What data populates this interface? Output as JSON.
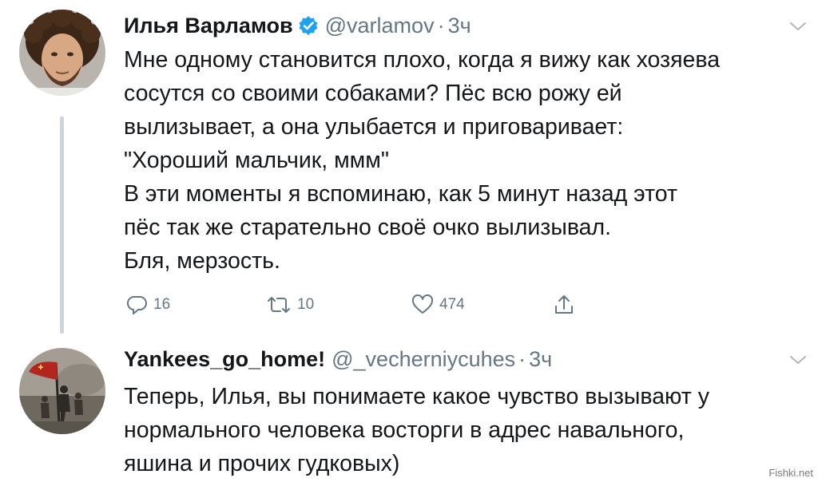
{
  "tweets": [
    {
      "author_name": "Илья Варламов",
      "handle": "@varlamov",
      "separator": "·",
      "time": "3ч",
      "verified": true,
      "text_lines": [
        "Мне одному становится плохо, когда я вижу как хозяева",
        "сосутся со своими собаками? Пёс всю рожу ей",
        "вылизывает, а она улыбается и приговаривает:",
        "\"Хороший мальчик, ммм\"",
        "В эти моменты я вспоминаю, как 5 минут назад этот",
        "пёс так же старательно своё очко вылизывал.",
        "Бля, мерзость."
      ],
      "actions": {
        "reply_count": "16",
        "retweet_count": "10",
        "like_count": "474"
      }
    },
    {
      "author_name": "Yankees_go_home!",
      "handle": "@_vecherniycuhes",
      "separator": "·",
      "time": "3ч",
      "verified": false,
      "text_lines": [
        "Теперь, Илья, вы понимаете какое чувство вызывают у",
        "нормального человека восторги в адрес навального,",
        "яшина и прочих гудковых)"
      ]
    }
  ],
  "icons": {
    "verified": "verified-badge-icon",
    "chevron": "chevron-down-icon",
    "reply": "reply-icon",
    "retweet": "retweet-icon",
    "like": "heart-icon",
    "share": "share-icon"
  },
  "colors": {
    "text": "#14171a",
    "secondary": "#657786",
    "verified": "#1da1f2",
    "thread_line": "#ccd6dd"
  },
  "watermark": "Fishki.net"
}
